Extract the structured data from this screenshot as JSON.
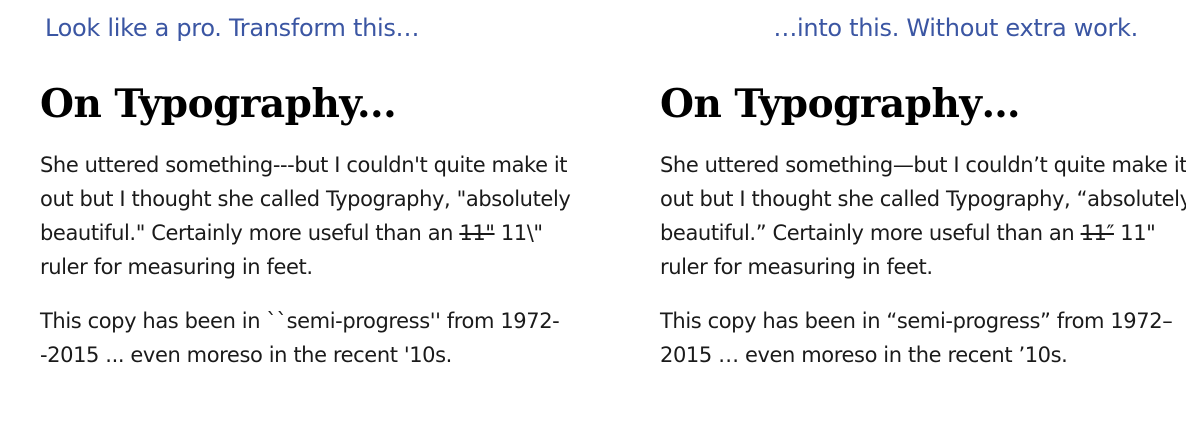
{
  "captions": {
    "left": "Look like a pro. Transform this…",
    "right": "…into this. Without extra work."
  },
  "before": {
    "heading": "On Typography...",
    "p1_start": "She uttered something---but I couldn't quite make it out but I thought she called Typography, \"absolutely beautiful.\" Certainly more useful than an ",
    "p1_strike": "11\"",
    "p1_end": " 11\\\" ruler for measuring in feet.",
    "p2": "This copy has been in ``semi-progress'' from 1972--2015 ... even moreso in the recent '10s."
  },
  "after": {
    "heading": "On Typography…",
    "p1_start": "She uttered something—but I couldn’t quite make it out but I thought she called Typography, “absolutely beautiful.” Certainly more useful than an ",
    "p1_strike": "11″",
    "p1_end": " 11\" ruler for measuring in feet.",
    "p2": "This copy has been in “semi-progress” from 1972–2015 … even moreso in the recent ’10s."
  }
}
